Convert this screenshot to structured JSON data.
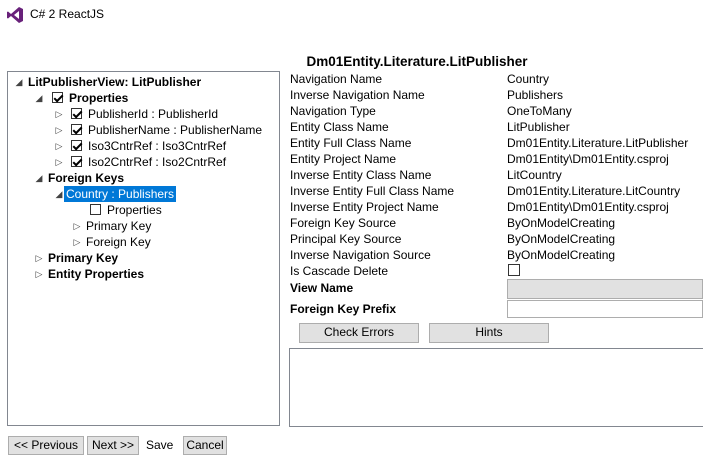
{
  "window": {
    "title": "C# 2 ReactJS",
    "icon": "visual-studio-icon"
  },
  "header": {
    "title": "Dm01Entity.Literature.LitPublisher"
  },
  "tree": {
    "root": "LitPublisherView: LitPublisher",
    "properties": "Properties",
    "prop_items": [
      "PublisherId : PublisherId",
      "PublisherName : PublisherName",
      "Iso3CntrRef : Iso3CntrRef",
      "Iso2CntrRef : Iso2CntrRef"
    ],
    "foreign_keys": "Foreign Keys",
    "fk_selected": "Country : Publishers",
    "fk_children": [
      "Properties",
      "Primary Key",
      "Foreign Key"
    ],
    "primary_key": "Primary Key",
    "entity_properties": "Entity Properties"
  },
  "properties": [
    {
      "label": "Navigation Name",
      "value": "Country"
    },
    {
      "label": "Inverse Navigation Name",
      "value": "Publishers"
    },
    {
      "label": "Navigation Type",
      "value": "OneToMany"
    },
    {
      "label": "Entity Class Name",
      "value": "LitPublisher"
    },
    {
      "label": "Entity Full Class Name",
      "value": "Dm01Entity.Literature.LitPublisher"
    },
    {
      "label": "Entity Project Name",
      "value": "Dm01Entity\\Dm01Entity.csproj"
    },
    {
      "label": "Inverse Entity Class Name",
      "value": "LitCountry"
    },
    {
      "label": "Inverse Entity Full Class Name",
      "value": "Dm01Entity.Literature.LitCountry"
    },
    {
      "label": "Inverse Entity Project Name",
      "value": "Dm01Entity\\Dm01Entity.csproj"
    },
    {
      "label": "Foreign Key Source",
      "value": "ByOnModelCreating"
    },
    {
      "label": "Principal Key Source",
      "value": "ByOnModelCreating"
    },
    {
      "label": "Inverse Navigation Source",
      "value": "ByOnModelCreating"
    }
  ],
  "cascade_delete": {
    "label": "Is Cascade Delete",
    "checked": false
  },
  "view_name": {
    "label": "View Name",
    "value": ""
  },
  "fk_prefix": {
    "label": "Foreign Key Prefix",
    "value": ""
  },
  "buttons": {
    "check_errors": "Check Errors",
    "hints": "Hints",
    "previous": "<< Previous",
    "next": "Next >>",
    "save": "Save",
    "cancel": "Cancel"
  }
}
